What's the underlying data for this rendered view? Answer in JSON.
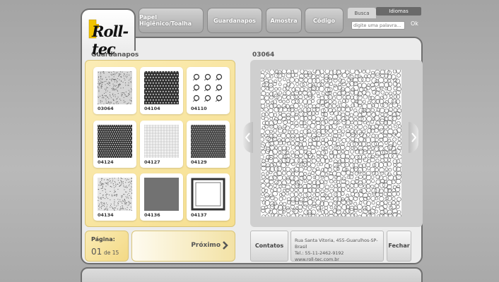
{
  "logo": {
    "text": "Roll-tec"
  },
  "nav": {
    "tabs": [
      {
        "label": "Papel Higiênico/Toalha"
      },
      {
        "label": "Guardanapos"
      },
      {
        "label": "Amostra"
      },
      {
        "label": "Código"
      }
    ]
  },
  "search": {
    "label": "Busca",
    "placeholder": "digite uma palavra...",
    "ok_label": "Ok"
  },
  "languages": {
    "label": "Idiomas"
  },
  "catalog": {
    "title": "Guardanapos",
    "items": [
      {
        "code": "03064",
        "pattern": "speckle"
      },
      {
        "code": "04104",
        "pattern": "diamond"
      },
      {
        "code": "04110",
        "pattern": "floral"
      },
      {
        "code": "04124",
        "pattern": "hex-mesh"
      },
      {
        "code": "04127",
        "pattern": "light-grid"
      },
      {
        "code": "04129",
        "pattern": "check"
      },
      {
        "code": "04134",
        "pattern": "fine-dots"
      },
      {
        "code": "04136",
        "pattern": "fine-grid"
      },
      {
        "code": "04137",
        "pattern": "border-frame"
      }
    ]
  },
  "preview": {
    "code": "03064",
    "pattern": "pebble"
  },
  "pagination": {
    "label": "Página:",
    "current": "01",
    "of_label": "de 15",
    "next_label": "Próximo"
  },
  "footer": {
    "contacts_label": "Contatos",
    "address_line1": "Rua Santa Vitoria, 455-Guarulhos-SP-Brasil",
    "phone": "Tel.: 55-11-2462-9192",
    "website": "www.roll-tec.com.br",
    "close_label": "Fechar"
  },
  "colors": {
    "panel_gold": "#f6df8f",
    "border_dark": "#6f6f6f",
    "nav_grey": "#b8b8b8"
  }
}
